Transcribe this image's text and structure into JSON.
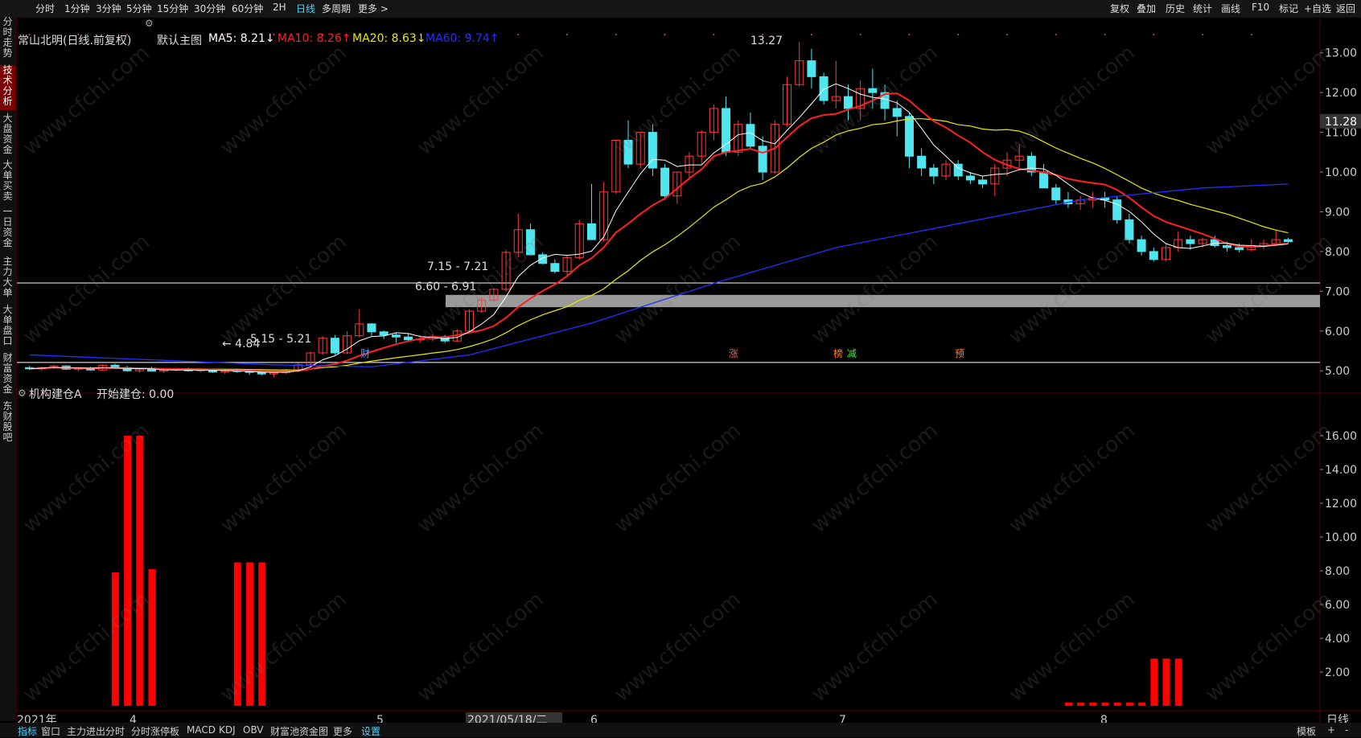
{
  "period_tabs": [
    "分时",
    "1分钟",
    "3分钟",
    "5分钟",
    "15分钟",
    "30分钟",
    "60分钟",
    "2H",
    "日线",
    "多周期",
    "更多 >"
  ],
  "active_period": "日线",
  "right_tools": [
    "复权",
    "叠加",
    "历史",
    "统计",
    "画线",
    "F10",
    "标记",
    "+自选",
    "返回"
  ],
  "left_tabs": [
    "分时走势",
    "技术分析",
    "大盘资金",
    "大单买卖",
    "一日资金",
    "主力大单",
    "大单盘口",
    "财富资金",
    "东财股吧"
  ],
  "active_left": "技术分析",
  "legend": {
    "stock": "常山北明(日线.前复权)",
    "main_chart": "默认主图",
    "ma5": "MA5: 8.21↓",
    "ma10": "MA10: 8.26↑",
    "ma20": "MA20: 8.63↓",
    "ma60": "MA60: 9.74↑"
  },
  "colors": {
    "ma5": "#ffffff",
    "ma10": "#ff2020",
    "ma20": "#e8e800",
    "ma60": "#2030ff",
    "up": "#ff3a3a",
    "down": "#50e6f0",
    "bg": "#000000"
  },
  "price_axis": [
    "13.00",
    "12.00",
    "11.00",
    "10.00",
    "9.00",
    "8.00",
    "7.00",
    "6.00",
    "5.00"
  ],
  "current_price": "11.28",
  "annotations": {
    "high": "13.27",
    "low": "4.84",
    "zone1": "7.15 - 7.21",
    "zone2": "6.60 - 6.91",
    "zone3": "5.15 - 5.21"
  },
  "event_markers": [
    {
      "label": "财",
      "color": "#4f9fff"
    },
    {
      "label": "涨",
      "color": "#ff5050"
    },
    {
      "label": "榜",
      "color": "#ff8030"
    },
    {
      "label": "减",
      "color": "#50e050"
    },
    {
      "label": "预",
      "color": "#ff8030"
    }
  ],
  "indicator": {
    "title": "机构建仓A",
    "value": "开始建仓: 0.00"
  },
  "indicator_axis": [
    "16.00",
    "14.00",
    "12.00",
    "10.00",
    "8.00",
    "6.00",
    "4.00",
    "2.00"
  ],
  "x_labels": [
    "2021年",
    "4",
    "5",
    "2021/05/18/二",
    "6",
    "7",
    "8"
  ],
  "period_label": "日线",
  "bottom_tabs": [
    "指标",
    "窗口",
    "主力进出分时",
    "分时涨停板",
    "MACD",
    "KDJ",
    "OBV",
    "财富池资金图",
    "更多",
    "设置"
  ],
  "bottom_right": [
    "模板",
    "+",
    "-"
  ],
  "watermark": "www.cfchi.com",
  "chart_data": {
    "type": "candlestick",
    "candles": [
      [
        5.08,
        5.12,
        5.02,
        5.05
      ],
      [
        5.05,
        5.1,
        5.0,
        5.08
      ],
      [
        5.08,
        5.15,
        5.05,
        5.12
      ],
      [
        5.12,
        5.14,
        5.02,
        5.04
      ],
      [
        5.04,
        5.08,
        4.98,
        5.06
      ],
      [
        5.06,
        5.1,
        5.0,
        5.02
      ],
      [
        5.02,
        5.16,
        5.0,
        5.14
      ],
      [
        5.14,
        5.18,
        5.05,
        5.08
      ],
      [
        5.08,
        5.12,
        4.98,
        5.0
      ],
      [
        5.0,
        5.06,
        4.95,
        5.04
      ],
      [
        5.04,
        5.1,
        4.98,
        4.99
      ],
      [
        4.99,
        5.04,
        4.95,
        5.02
      ],
      [
        5.02,
        5.08,
        4.98,
        5.05
      ],
      [
        5.05,
        5.08,
        4.98,
        5.0
      ],
      [
        5.0,
        5.05,
        4.96,
        5.03
      ],
      [
        5.03,
        5.06,
        4.95,
        4.97
      ],
      [
        4.97,
        5.02,
        4.92,
        5.0
      ],
      [
        5.0,
        5.05,
        4.95,
        4.98
      ],
      [
        4.98,
        5.04,
        4.9,
        4.96
      ],
      [
        4.96,
        5.0,
        4.88,
        4.92
      ],
      [
        4.92,
        4.97,
        4.84,
        4.95
      ],
      [
        4.95,
        5.05,
        4.92,
        5.02
      ],
      [
        5.02,
        5.2,
        5.0,
        5.15
      ],
      [
        5.15,
        5.48,
        5.1,
        5.45
      ],
      [
        5.45,
        5.88,
        5.4,
        5.82
      ],
      [
        5.82,
        5.9,
        5.4,
        5.45
      ],
      [
        5.45,
        6.0,
        5.42,
        5.88
      ],
      [
        5.88,
        6.55,
        5.85,
        6.18
      ],
      [
        6.18,
        6.2,
        5.88,
        5.98
      ],
      [
        5.98,
        6.02,
        5.8,
        5.9
      ],
      [
        5.9,
        5.96,
        5.7,
        5.85
      ],
      [
        5.85,
        5.95,
        5.72,
        5.78
      ],
      [
        5.78,
        5.88,
        5.7,
        5.8
      ],
      [
        5.8,
        5.92,
        5.74,
        5.86
      ],
      [
        5.86,
        5.9,
        5.7,
        5.75
      ],
      [
        5.75,
        6.05,
        5.72,
        6.0
      ],
      [
        6.0,
        6.55,
        5.98,
        6.5
      ],
      [
        6.5,
        6.85,
        6.45,
        6.78
      ],
      [
        6.78,
        7.08,
        6.75,
        7.05
      ],
      [
        7.05,
        8.05,
        7.0,
        7.98
      ],
      [
        7.98,
        8.95,
        7.85,
        8.55
      ],
      [
        8.55,
        8.7,
        7.9,
        7.92
      ],
      [
        7.92,
        7.98,
        7.68,
        7.7
      ],
      [
        7.7,
        7.8,
        7.45,
        7.5
      ],
      [
        7.5,
        7.9,
        7.4,
        7.85
      ],
      [
        7.85,
        8.8,
        7.8,
        8.7
      ],
      [
        8.7,
        9.7,
        8.65,
        8.3
      ],
      [
        8.3,
        9.75,
        8.25,
        9.5
      ],
      [
        9.5,
        10.8,
        9.45,
        10.8
      ],
      [
        10.8,
        11.3,
        10.1,
        10.2
      ],
      [
        10.2,
        11.0,
        10.1,
        11.0
      ],
      [
        11.0,
        11.2,
        9.9,
        10.1
      ],
      [
        10.1,
        10.2,
        9.3,
        9.4
      ],
      [
        9.4,
        10.0,
        9.2,
        10.0
      ],
      [
        10.0,
        10.5,
        9.8,
        10.4
      ],
      [
        10.4,
        11.05,
        10.2,
        11.0
      ],
      [
        11.0,
        11.7,
        10.8,
        11.6
      ],
      [
        11.6,
        11.9,
        10.4,
        10.5
      ],
      [
        10.5,
        11.3,
        10.4,
        11.2
      ],
      [
        11.2,
        11.5,
        10.6,
        10.65
      ],
      [
        10.65,
        10.9,
        9.8,
        10.0
      ],
      [
        10.0,
        11.3,
        9.95,
        11.2
      ],
      [
        11.2,
        12.4,
        11.15,
        12.2
      ],
      [
        12.2,
        13.27,
        12.15,
        12.8
      ],
      [
        12.8,
        13.1,
        12.1,
        12.4
      ],
      [
        12.4,
        12.5,
        11.7,
        11.8
      ],
      [
        11.8,
        12.8,
        11.6,
        11.9
      ],
      [
        11.9,
        12.2,
        11.3,
        11.6
      ],
      [
        11.6,
        12.3,
        11.3,
        12.1
      ],
      [
        12.1,
        12.6,
        11.6,
        12.0
      ],
      [
        12.0,
        12.2,
        11.3,
        11.6
      ],
      [
        11.6,
        11.8,
        10.9,
        11.4
      ],
      [
        11.4,
        11.5,
        10.1,
        10.4
      ],
      [
        10.4,
        10.6,
        9.9,
        10.1
      ],
      [
        10.1,
        10.2,
        9.7,
        9.9
      ],
      [
        9.9,
        10.3,
        9.8,
        10.2
      ],
      [
        10.2,
        10.3,
        9.8,
        9.9
      ],
      [
        9.9,
        10.0,
        9.7,
        9.8
      ],
      [
        9.8,
        9.9,
        9.6,
        9.7
      ],
      [
        9.7,
        10.2,
        9.4,
        10.1
      ],
      [
        10.1,
        10.5,
        9.9,
        10.3
      ],
      [
        10.3,
        10.7,
        10.1,
        10.4
      ],
      [
        10.4,
        10.5,
        9.9,
        10.0
      ],
      [
        10.0,
        10.2,
        9.6,
        9.6
      ],
      [
        9.6,
        9.7,
        9.2,
        9.3
      ],
      [
        9.3,
        9.5,
        9.1,
        9.2
      ],
      [
        9.2,
        9.4,
        9.05,
        9.3
      ],
      [
        9.3,
        9.5,
        9.1,
        9.35
      ],
      [
        9.35,
        9.5,
        9.1,
        9.3
      ],
      [
        9.3,
        9.4,
        8.7,
        8.8
      ],
      [
        8.8,
        8.95,
        8.2,
        8.3
      ],
      [
        8.3,
        8.4,
        7.9,
        8.0
      ],
      [
        8.0,
        8.1,
        7.75,
        7.8
      ],
      [
        7.8,
        8.2,
        7.75,
        8.1
      ],
      [
        8.1,
        8.5,
        8.0,
        8.3
      ],
      [
        8.3,
        8.4,
        8.05,
        8.2
      ],
      [
        8.2,
        8.35,
        8.1,
        8.3
      ],
      [
        8.3,
        8.4,
        8.1,
        8.15
      ],
      [
        8.15,
        8.25,
        8.0,
        8.1
      ],
      [
        8.1,
        8.2,
        7.98,
        8.05
      ],
      [
        8.05,
        8.3,
        8.0,
        8.15
      ],
      [
        8.15,
        8.3,
        8.05,
        8.2
      ],
      [
        8.2,
        8.55,
        8.15,
        8.3
      ],
      [
        8.3,
        8.35,
        8.2,
        8.25
      ]
    ],
    "ma60_points": [
      [
        0,
        5.4
      ],
      [
        20,
        5.15
      ],
      [
        28,
        5.1
      ],
      [
        36,
        5.4
      ],
      [
        46,
        6.2
      ],
      [
        56,
        7.2
      ],
      [
        66,
        8.1
      ],
      [
        76,
        8.7
      ],
      [
        86,
        9.3
      ],
      [
        96,
        9.6
      ],
      [
        103,
        9.7
      ]
    ],
    "indicator_bars": [
      [
        7,
        7.9
      ],
      [
        8,
        16.0
      ],
      [
        9,
        16.0
      ],
      [
        10,
        8.1
      ],
      [
        17,
        8.5
      ],
      [
        18,
        8.5
      ],
      [
        19,
        8.5
      ],
      [
        85,
        0.2
      ],
      [
        86,
        0.2
      ],
      [
        87,
        0.2
      ],
      [
        88,
        0.2
      ],
      [
        89,
        0.2
      ],
      [
        90,
        0.2
      ],
      [
        91,
        0.2
      ],
      [
        92,
        2.8
      ],
      [
        93,
        2.8
      ],
      [
        94,
        2.8
      ]
    ],
    "price_ylim": [
      4.6,
      13.5
    ],
    "indicator_ylim": [
      0,
      17
    ]
  }
}
